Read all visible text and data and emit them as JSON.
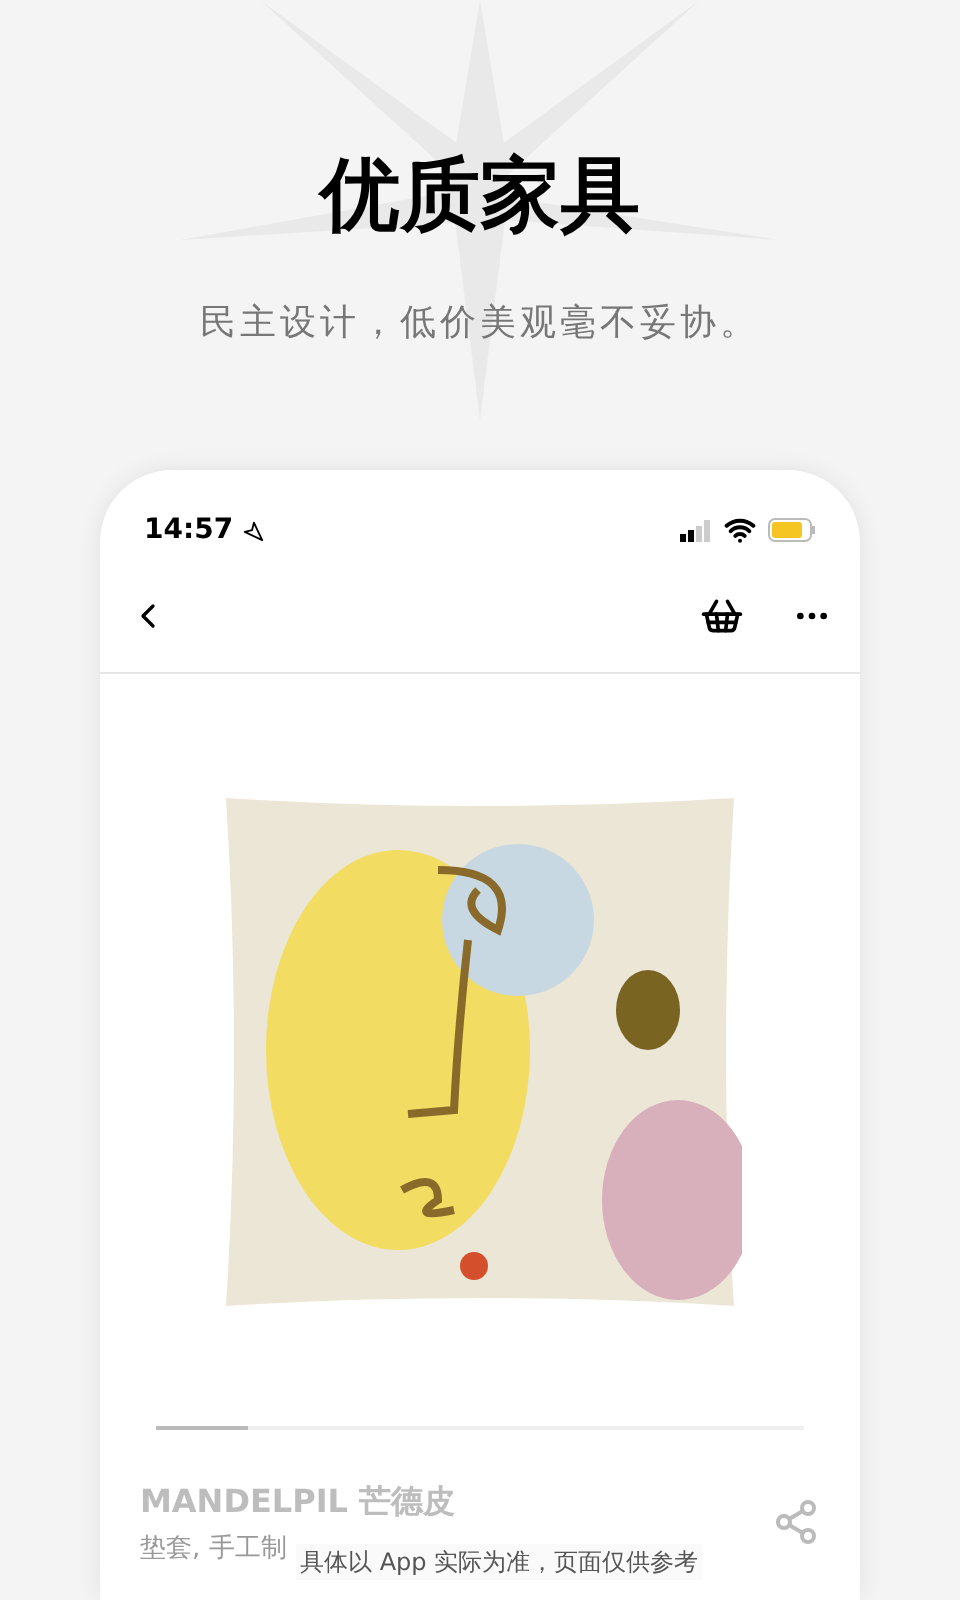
{
  "headline": "优质家具",
  "tagline": "民主设计，低价美观毫不妥协。",
  "phone": {
    "status_bar": {
      "time": "14:57"
    },
    "product": {
      "name": "MANDELPIL 芒德皮",
      "description": "垫套, 手工制"
    }
  },
  "disclaimer": "具体以 App 实际为准，页面仅供参考"
}
